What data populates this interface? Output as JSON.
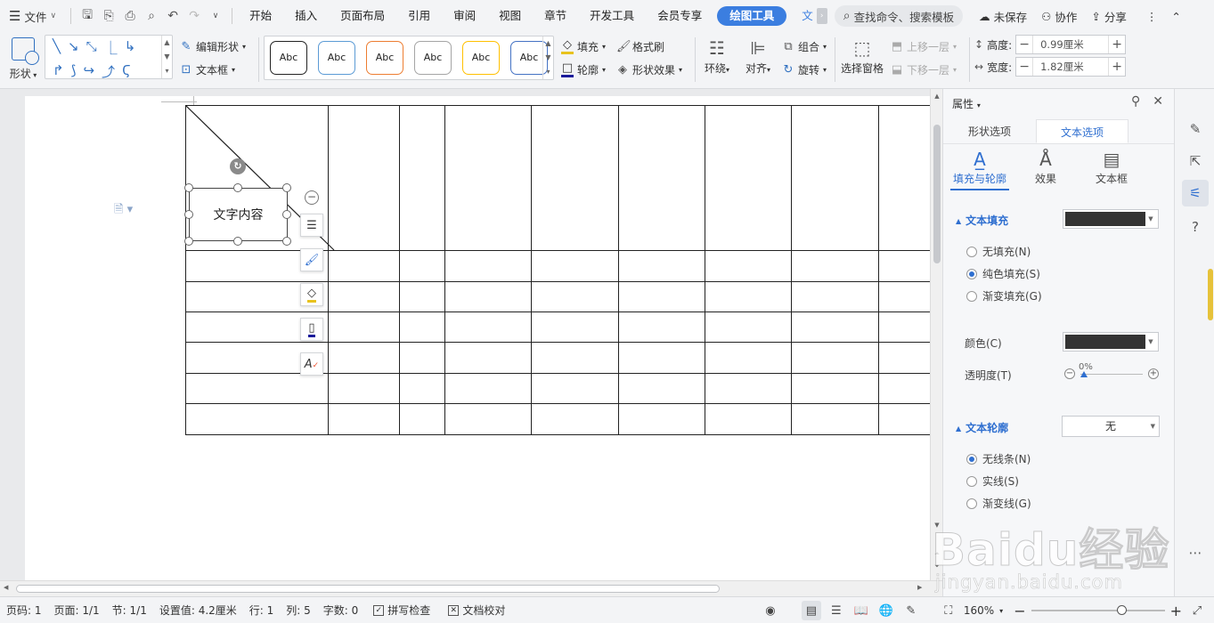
{
  "menubar": {
    "file_label": "文件",
    "tabs": [
      "开始",
      "插入",
      "页面布局",
      "引用",
      "审阅",
      "视图",
      "章节",
      "开发工具",
      "会员专享"
    ],
    "active_tab": "绘图工具",
    "clipped_tab": "文",
    "search_placeholder": "查找命令、搜索模板",
    "unsaved": "未保存",
    "collab": "协作",
    "share": "分享"
  },
  "ribbon": {
    "shape_label": "形状",
    "edit_shape": "编辑形状",
    "text_box": "文本框",
    "style_samples": [
      "Abc",
      "Abc",
      "Abc",
      "Abc",
      "Abc",
      "Abc"
    ],
    "style_colors": [
      "#222222",
      "#5b9bd5",
      "#ed7d31",
      "#a5a5a5",
      "#ffc000",
      "#4472c4"
    ],
    "fill": "填充",
    "outline": "轮廓",
    "format_painter": "格式刷",
    "shape_effects": "形状效果",
    "wrap": "环绕",
    "align": "对齐",
    "group": "组合",
    "rotate": "旋转",
    "select_pane": "选择窗格",
    "bring_forward": "上移一层",
    "send_backward": "下移一层",
    "height_label": "高度:",
    "height_value": "0.99厘米",
    "width_label": "宽度:",
    "width_value": "1.82厘米"
  },
  "document": {
    "textbox_text": "文字内容",
    "table_rows": 7,
    "table_cols": 9
  },
  "panel": {
    "title": "属性",
    "tab_shape": "形状选项",
    "tab_text": "文本选项",
    "sub_fill": "填充与轮廓",
    "sub_effect": "效果",
    "sub_textbox": "文本框",
    "text_fill": "文本填充",
    "no_fill": "无填充(N)",
    "solid_fill": "纯色填充(S)",
    "gradient_fill": "渐变填充(G)",
    "color_label": "颜色(C)",
    "transparency_label": "透明度(T)",
    "transparency_value": "0%",
    "text_outline": "文本轮廓",
    "outline_value": "无",
    "no_line": "无线条(N)",
    "solid_line": "实线(S)",
    "gradient_line": "渐变线(G)",
    "fill_color": "#333333"
  },
  "statusbar": {
    "page_no": "页码: 1",
    "pages": "页面: 1/1",
    "section": "节: 1/1",
    "setting": "设置值: 4.2厘米",
    "row": "行: 1",
    "col": "列: 5",
    "words": "字数: 0",
    "spell_check": "拼写检查",
    "doc_check": "文档校对",
    "zoom": "160%"
  },
  "watermark": {
    "line1": "Baidu经验",
    "line2": "jingyan.baidu.com"
  }
}
